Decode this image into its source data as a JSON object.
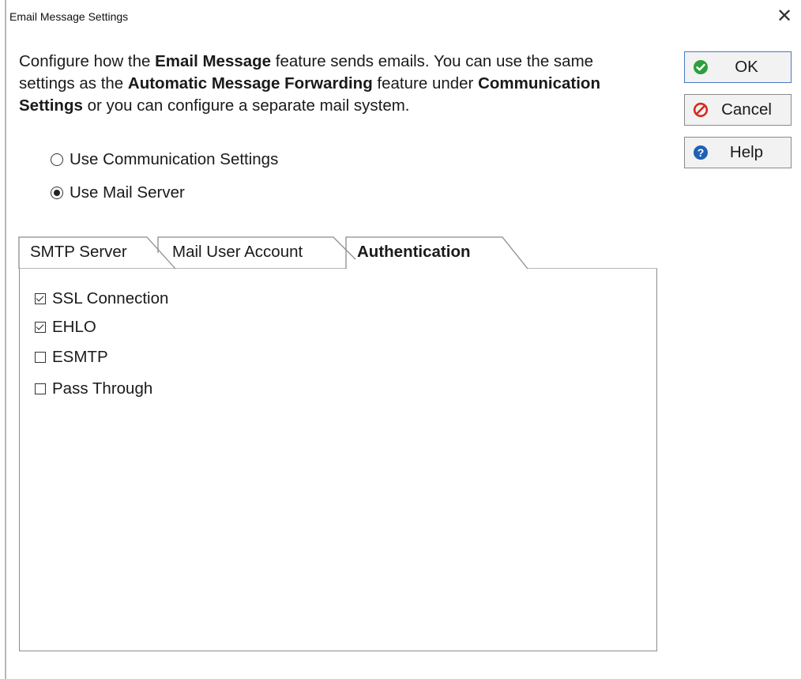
{
  "window": {
    "title": "Email Message Settings",
    "close_glyph": "✕"
  },
  "description": {
    "p1": "Configure how the ",
    "b1": "Email Message",
    "p2": " feature sends emails.  You can use the same settings as the ",
    "b2": "Automatic Message Forwarding",
    "p3": " feature under ",
    "b3": "Communication Settings",
    "p4": " or you can configure a separate mail system."
  },
  "mail_source": {
    "options": [
      {
        "label": "Use Communication Settings",
        "selected": false
      },
      {
        "label": "Use Mail Server",
        "selected": true
      }
    ]
  },
  "buttons": {
    "ok": {
      "label": "OK",
      "icon": "check-circle-icon",
      "color": "#2e9e3e"
    },
    "cancel": {
      "label": "Cancel",
      "icon": "no-entry-icon",
      "color": "#d42b1e"
    },
    "help": {
      "label": "Help",
      "icon": "question-circle-icon",
      "color": "#1f5fb6"
    }
  },
  "tabs": [
    {
      "label": "SMTP Server",
      "active": false
    },
    {
      "label": "Mail User Account",
      "active": false
    },
    {
      "label": "Authentication",
      "active": true
    }
  ],
  "authentication": {
    "options": [
      {
        "label": "SSL Connection",
        "checked": true
      },
      {
        "label": "EHLO",
        "checked": true
      },
      {
        "label": "ESMTP",
        "checked": false
      },
      {
        "label": "Pass Through",
        "checked": false
      }
    ]
  }
}
